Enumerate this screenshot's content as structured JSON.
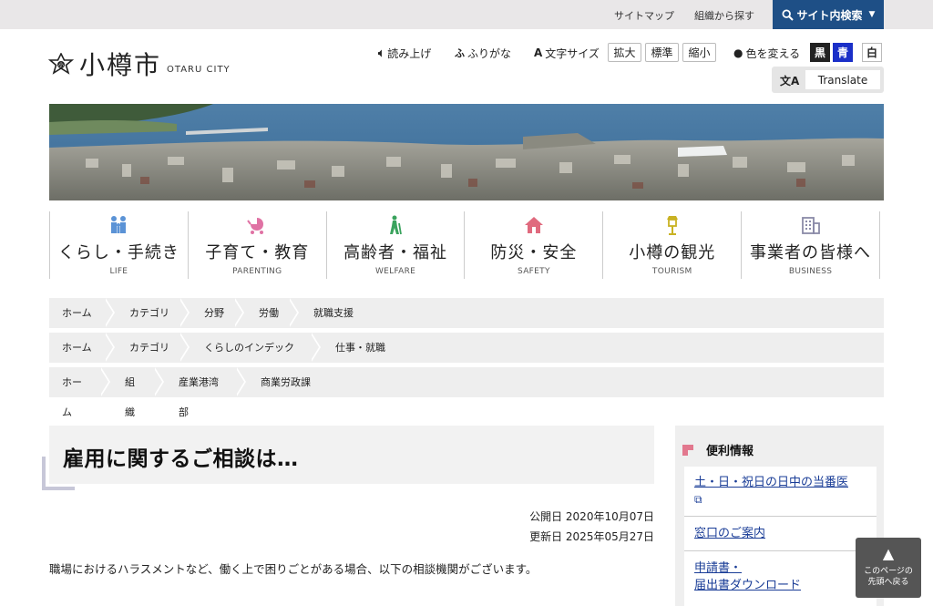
{
  "topbar": {
    "sitemap": "サイトマップ",
    "org_search": "組織から探す",
    "site_search": "サイト内検索"
  },
  "logo": {
    "name_ja": "小樽市",
    "name_en": "OTARU CITY"
  },
  "tools": {
    "read_aloud": "読み上げ",
    "furigana": "ふりがな",
    "text_size": "文字サイズ",
    "enlarge": "拡大",
    "standard": "標準",
    "shrink": "縮小",
    "color_change": "色を変える",
    "black": "黒",
    "blue": "青",
    "white": "白",
    "translate": "Translate"
  },
  "categories": [
    {
      "ja": "くらし・手続き",
      "en": "LIFE",
      "icon": "family-icon",
      "color": "#5b93d6"
    },
    {
      "ja": "子育て・教育",
      "en": "PARENTING",
      "icon": "stroller-icon",
      "color": "#e072a4"
    },
    {
      "ja": "高齢者・福祉",
      "en": "WELFARE",
      "icon": "walking-elder-icon",
      "color": "#3aa35d"
    },
    {
      "ja": "防災・安全",
      "en": "SAFETY",
      "icon": "house-icon",
      "color": "#e06a7e"
    },
    {
      "ja": "小樽の観光",
      "en": "TOURISM",
      "icon": "gas-lamp-icon",
      "color": "#c9b223"
    },
    {
      "ja": "事業者の皆様へ",
      "en": "BUSINESS",
      "icon": "building-icon",
      "color": "#8a8aa8"
    }
  ],
  "breadcrumbs": [
    [
      "ホーム",
      "カテゴリ",
      "分野",
      "労働",
      "就職支援"
    ],
    [
      "ホーム",
      "カテゴリ",
      "くらしのインデックス",
      "仕事・就職"
    ],
    [
      "ホーム",
      "組織",
      "産業港湾部",
      "商業労政課"
    ]
  ],
  "page": {
    "title": "雇用に関するご相談は…",
    "published": "公開日 2020年10月07日",
    "updated": "更新日 2025年05月27日",
    "intro": "職場におけるハラスメントなど、働く上で困りごとがある場合、以下の相談機関がございます。"
  },
  "sidebar": {
    "heading": "便利情報",
    "items": [
      "土・日・祝日の日中の当番医",
      "窓口のご案内",
      "申請書・",
      "届出書ダウンロード"
    ]
  },
  "pagetop": {
    "line1": "このページの",
    "line2": "先頭へ戻る"
  },
  "colors": {
    "search_bar": "#1e4f86",
    "link": "#1a3d97",
    "accent_pink": "#e2788e"
  }
}
